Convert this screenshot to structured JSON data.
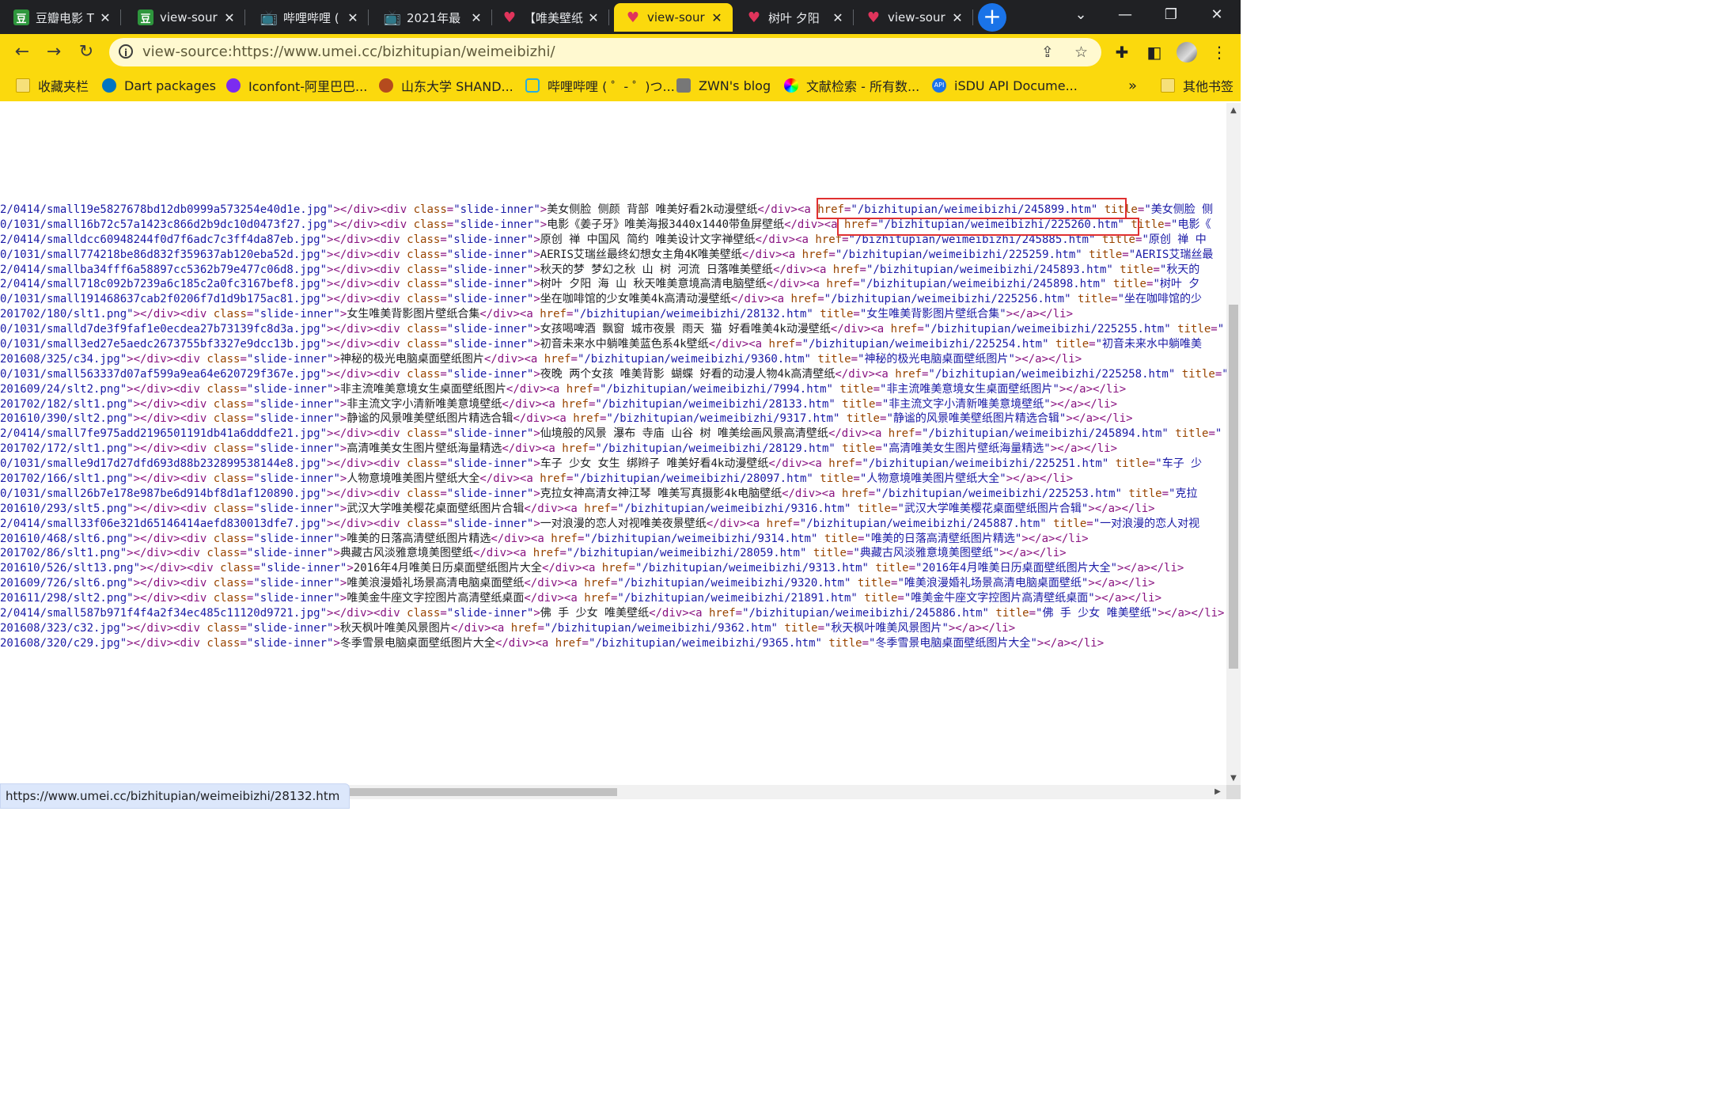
{
  "tabs": [
    {
      "title": "豆瓣电影 T",
      "favicon": "douban-icon",
      "active": false
    },
    {
      "title": "view-sour",
      "favicon": "douban-icon",
      "active": false
    },
    {
      "title": "哔哩哔哩 (",
      "favicon": "bilibili-icon",
      "active": false
    },
    {
      "title": "2021年最",
      "favicon": "bilibili-icon",
      "active": false
    },
    {
      "title": "【唯美壁纸",
      "favicon": "heart-icon",
      "active": false
    },
    {
      "title": "view-sour",
      "favicon": "heart-icon",
      "active": true
    },
    {
      "title": "树叶 夕阳",
      "favicon": "heart-icon",
      "active": false
    },
    {
      "title": "view-sour",
      "favicon": "heart-icon",
      "active": false
    }
  ],
  "address_bar": {
    "url": "view-source:https://www.umei.cc/bizhitupian/weimeibizhi/"
  },
  "bookmarks": [
    {
      "label": "收藏夹栏",
      "icon": "folder"
    },
    {
      "label": "Dart packages",
      "icon": "dart"
    },
    {
      "label": "Iconfont-阿里巴巴...",
      "icon": "iconfont"
    },
    {
      "label": "山东大学 SHAND...",
      "icon": "sdu"
    },
    {
      "label": "哔哩哔哩 ( ゜- ゜)つ...",
      "icon": "bili2"
    },
    {
      "label": "ZWN's blog",
      "icon": "zwn"
    },
    {
      "label": "文献检索 - 所有数...",
      "icon": "cnki"
    },
    {
      "label": "iSDU API Docume...",
      "icon": "api"
    }
  ],
  "bookmarks_overflow": "»",
  "other_bookmarks": "其他书签",
  "source_lines": [
    {
      "img": "2/0414/small19e5827678bd12db0999a573254e40d1e.jpg",
      "title": "美女侧脸 侧颜 背部 唯美好看2k动漫壁纸",
      "href": "/bizhitupian/weimeibizhi/245899.htm",
      "attr_title": "美女侧脸 侧"
    },
    {
      "img": "0/1031/small16b72c57a1423c866d2b9dc10d0473f27.jpg",
      "title": "电影《姜子牙》唯美海报3440x1440带鱼屏壁纸",
      "href": "/bizhitupian/weimeibizhi/225260.htm",
      "attr_title": "电影《"
    },
    {
      "img": "2/0414/smalldcc60948244f0d7f6adc7c3ff4da87eb.jpg",
      "title": "原创 禅 中国风 简约 唯美设计文字禅壁纸",
      "href": "/bizhitupian/weimeibizhi/245885.htm",
      "attr_title": "原创 禅 中"
    },
    {
      "img": "0/1031/small774218be86d832f359637ab120eba52d.jpg",
      "title": "AERIS艾瑞丝最终幻想女主角4K唯美壁纸",
      "href": "/bizhitupian/weimeibizhi/225259.htm",
      "attr_title": "AERIS艾瑞丝最"
    },
    {
      "img": "2/0414/smallba34fff6a58897cc5362b79e477c06d8.jpg",
      "title": "秋天的梦 梦幻之秋 山 树 河流 日落唯美壁纸",
      "href": "/bizhitupian/weimeibizhi/245893.htm",
      "attr_title": "秋天的"
    },
    {
      "img": "2/0414/small718c092b7239a6c185c2a0fc3167bef8.jpg",
      "title": "树叶 夕阳 海 山 秋天唯美意境高清电脑壁纸",
      "href": "/bizhitupian/weimeibizhi/245898.htm",
      "attr_title": "树叶 夕"
    },
    {
      "img": "0/1031/small191468637cab2f0206f7d1d9b175ac81.jpg",
      "title": "坐在咖啡馆的少女唯美4k高清动漫壁纸",
      "href": "/bizhitupian/weimeibizhi/225256.htm",
      "attr_title": "坐在咖啡馆的少"
    },
    {
      "img": "201702/180/slt1.png",
      "title": "女生唯美背影图片壁纸合集",
      "href": "/bizhitupian/weimeibizhi/28132.htm",
      "attr_title": "女生唯美背影图片壁纸合集",
      "end": true
    },
    {
      "img": "0/1031/smalld7de3f9faf1e0ecdea27b73139fc8d3a.jpg",
      "title": "女孩喝啤酒 飘窗 城市夜景 雨天 猫 好看唯美4k动漫壁纸",
      "href": "/bizhitupian/weimeibizhi/225255.htm",
      "attr_title": ""
    },
    {
      "img": "0/1031/small3ed27e5aedc2673755bf3327e9dcc13b.jpg",
      "title": "初音未来水中躺唯美蓝色系4k壁纸",
      "href": "/bizhitupian/weimeibizhi/225254.htm",
      "attr_title": "初音未来水中躺唯美"
    },
    {
      "img": "201608/325/c34.jpg",
      "title": "神秘的极光电脑桌面壁纸图片",
      "href": "/bizhitupian/weimeibizhi/9360.htm",
      "attr_title": "神秘的极光电脑桌面壁纸图片",
      "end": true
    },
    {
      "img": "0/1031/small563337d07af599a9ea64e620729f367e.jpg",
      "title": "夜晚 两个女孩 唯美背影 蝴蝶 好看的动漫人物4k高清壁纸",
      "href": "/bizhitupian/weimeibizhi/225258.htm",
      "attr_title": ""
    },
    {
      "img": "201609/24/slt2.png",
      "title": "非主流唯美意境女生桌面壁纸图片",
      "href": "/bizhitupian/weimeibizhi/7994.htm",
      "attr_title": "非主流唯美意境女生桌面壁纸图片",
      "end": true
    },
    {
      "img": "201702/182/slt1.png",
      "title": "非主流文字小清新唯美意境壁纸",
      "href": "/bizhitupian/weimeibizhi/28133.htm",
      "attr_title": "非主流文字小清新唯美意境壁纸",
      "end": true
    },
    {
      "img": "201610/390/slt2.png",
      "title": "静谧的风景唯美壁纸图片精选合辑",
      "href": "/bizhitupian/weimeibizhi/9317.htm",
      "attr_title": "静谧的风景唯美壁纸图片精选合辑",
      "end": true
    },
    {
      "img": "2/0414/small7fe975add2196501191db41a6dddfe21.jpg",
      "title": "仙境般的风景 瀑布 寺庙 山谷 树 唯美绘画风景高清壁纸",
      "href": "/bizhitupian/weimeibizhi/245894.htm",
      "attr_title": ""
    },
    {
      "img": "201702/172/slt1.png",
      "title": "高清唯美女生图片壁纸海量精选",
      "href": "/bizhitupian/weimeibizhi/28129.htm",
      "attr_title": "高清唯美女生图片壁纸海量精选",
      "end": true
    },
    {
      "img": "0/1031/smalle9d17d27dfd693d88b232899538144e8.jpg",
      "title": "车子 少女 女生 绑辫子 唯美好看4k动漫壁纸",
      "href": "/bizhitupian/weimeibizhi/225251.htm",
      "attr_title": "车子 少"
    },
    {
      "img": "201702/166/slt1.png",
      "title": "人物意境唯美图片壁纸大全",
      "href": "/bizhitupian/weimeibizhi/28097.htm",
      "attr_title": "人物意境唯美图片壁纸大全",
      "end": true
    },
    {
      "img": "0/1031/small26b7e178e987be6d914bf8d1af120890.jpg",
      "title": "克拉女神高清女神江琴 唯美写真摄影4k电脑壁纸",
      "href": "/bizhitupian/weimeibizhi/225253.htm",
      "attr_title": "克拉"
    },
    {
      "img": "201610/293/slt5.png",
      "title": "武汉大学唯美樱花桌面壁纸图片合辑",
      "href": "/bizhitupian/weimeibizhi/9316.htm",
      "attr_title": "武汉大学唯美樱花桌面壁纸图片合辑",
      "end": true
    },
    {
      "img": "2/0414/small33f06e321d65146414aefd830013dfe7.jpg",
      "title": "一对浪漫的恋人对视唯美夜景壁纸",
      "href": "/bizhitupian/weimeibizhi/245887.htm",
      "attr_title": "一对浪漫的恋人对视"
    },
    {
      "img": "201610/468/slt6.png",
      "title": "唯美的日落高清壁纸图片精选",
      "href": "/bizhitupian/weimeibizhi/9314.htm",
      "attr_title": "唯美的日落高清壁纸图片精选",
      "end": true
    },
    {
      "img": "201702/86/slt1.png",
      "title": "典藏古风淡雅意境美图壁纸",
      "href": "/bizhitupian/weimeibizhi/28059.htm",
      "attr_title": "典藏古风淡雅意境美图壁纸",
      "end": true
    },
    {
      "img": "201610/526/slt13.png",
      "title": "2016年4月唯美日历桌面壁纸图片大全",
      "href": "/bizhitupian/weimeibizhi/9313.htm",
      "attr_title": "2016年4月唯美日历桌面壁纸图片大全",
      "end": true
    },
    {
      "img": "201609/726/slt6.png",
      "title": "唯美浪漫婚礼场景高清电脑桌面壁纸",
      "href": "/bizhitupian/weimeibizhi/9320.htm",
      "attr_title": "唯美浪漫婚礼场景高清电脑桌面壁纸",
      "end": true
    },
    {
      "img": "201611/298/slt2.png",
      "title": "唯美金牛座文字控图片高清壁纸桌面",
      "href": "/bizhitupian/weimeibizhi/21891.htm",
      "attr_title": "唯美金牛座文字控图片高清壁纸桌面",
      "end": true
    },
    {
      "img": "2/0414/small587b971f4f4a2f34ec485c11120d9721.jpg",
      "title": "佛 手 少女 唯美壁纸",
      "href": "/bizhitupian/weimeibizhi/245886.htm",
      "attr_title": "佛 手 少女 唯美壁纸",
      "end": true
    },
    {
      "img": "201608/323/c32.jpg",
      "title": "秋天枫叶唯美风景图片",
      "href": "/bizhitupian/weimeibizhi/9362.htm",
      "attr_title": "秋天枫叶唯美风景图片",
      "end": true
    },
    {
      "img": "201608/320/c29.jpg",
      "title": "冬季雪景电脑桌面壁纸图片大全",
      "href": "/bizhitupian/weimeibizhi/9365.htm",
      "attr_title": "冬季雪景电脑桌面壁纸图片大全",
      "end": true
    }
  ],
  "status_url": "https://www.umei.cc/bizhitupian/weimeibizhi/28132.htm"
}
